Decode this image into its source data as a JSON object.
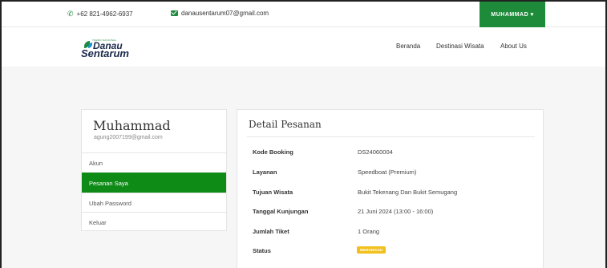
{
  "topbar": {
    "phone": "+62 821-4962-6937",
    "email": "danausentarum07@gmail.com",
    "user_menu": "MUHAMMAD ▾",
    "phone_icon": "phone-icon",
    "email_icon": "mail-icon"
  },
  "nav": {
    "logo_small": "TAMAN NASIONAL",
    "logo_line1": "Danau",
    "logo_line2": "Sentarum",
    "links": [
      "Beranda",
      "Destinasi Wisata",
      "About Us"
    ]
  },
  "sidebar": {
    "name": "Muhammad",
    "email": "agung2007199@gmail.com",
    "items": [
      {
        "label": "Akun",
        "active": false
      },
      {
        "label": "Pesanan Saya",
        "active": true
      },
      {
        "label": "Ubah Password",
        "active": false
      },
      {
        "label": "Keluar",
        "active": false
      }
    ]
  },
  "detail": {
    "title": "Detail Pesanan",
    "rows": [
      {
        "label": "Kode Booking",
        "value": "DS24060004"
      },
      {
        "label": "Layanan",
        "value": "Speedboat (Premium)"
      },
      {
        "label": "Tujuan Wisata",
        "value": "Bukit Tekenang Dan Bukit Semugang"
      },
      {
        "label": "Tanggal Kunjungan",
        "value": "21 Juni 2024 (13:00 - 16:00)"
      },
      {
        "label": "Jumlah Tiket",
        "value": "1 Orang"
      },
      {
        "label": "Status",
        "value": "MENUNGGU"
      }
    ]
  },
  "colors": {
    "brand_green": "#1e8b3a",
    "active_green": "#0e8a17",
    "status_yellow": "#f2c01d"
  }
}
